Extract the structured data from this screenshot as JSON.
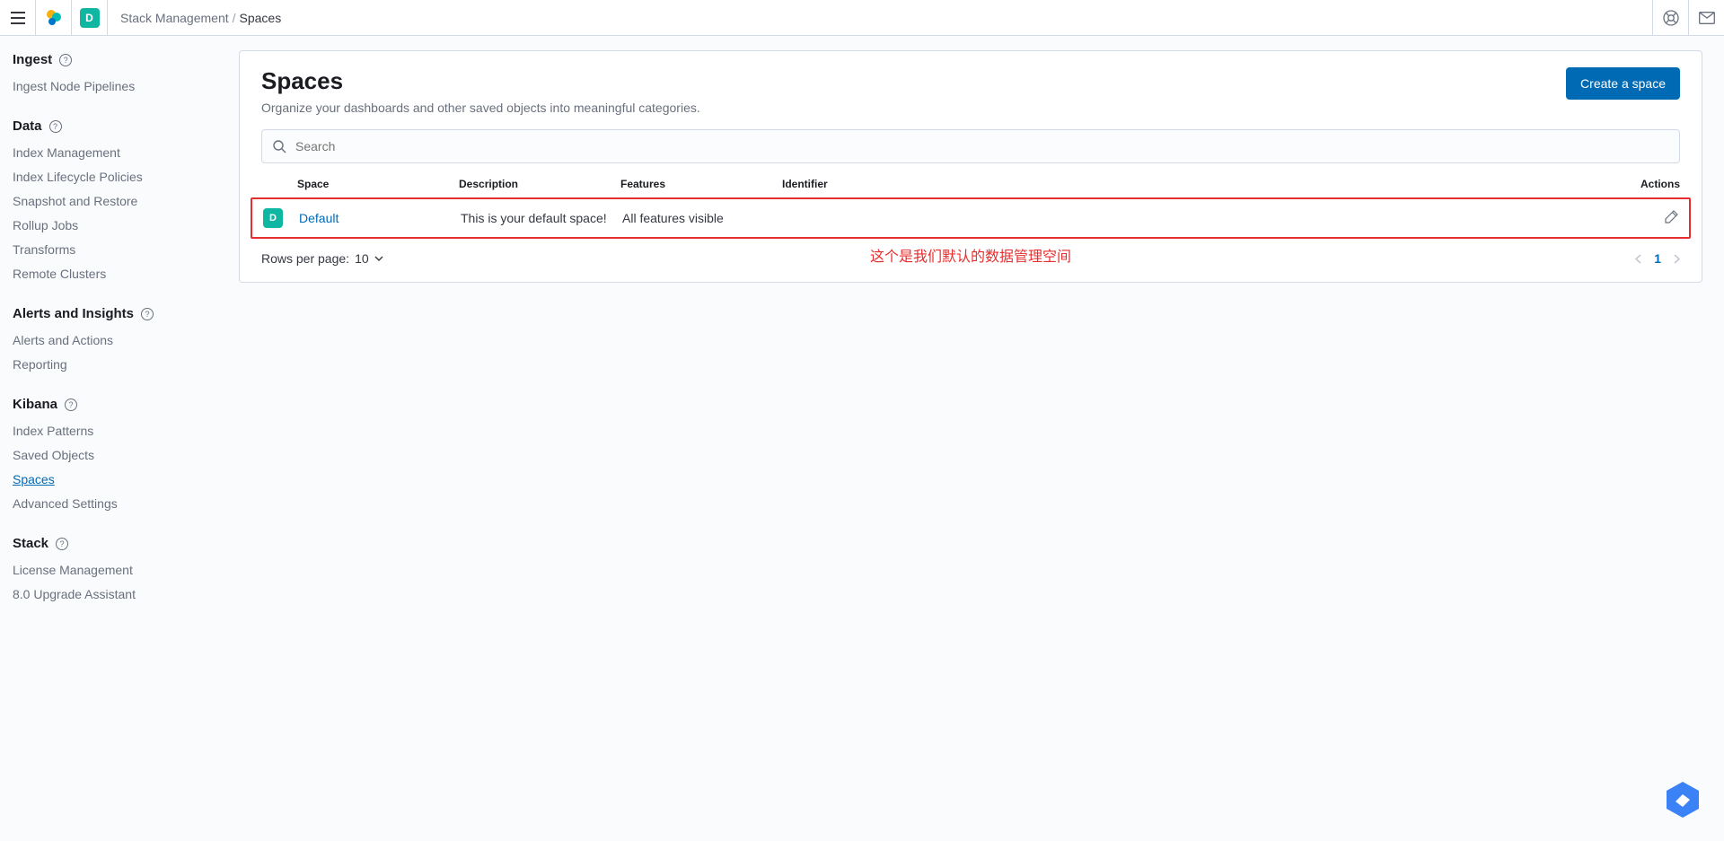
{
  "header": {
    "breadcrumb_parent": "Stack Management",
    "breadcrumb_current": "Spaces",
    "space_initial": "D"
  },
  "sidebar": {
    "sections": [
      {
        "title": "Ingest",
        "items": [
          "Ingest Node Pipelines"
        ]
      },
      {
        "title": "Data",
        "items": [
          "Index Management",
          "Index Lifecycle Policies",
          "Snapshot and Restore",
          "Rollup Jobs",
          "Transforms",
          "Remote Clusters"
        ]
      },
      {
        "title": "Alerts and Insights",
        "items": [
          "Alerts and Actions",
          "Reporting"
        ]
      },
      {
        "title": "Kibana",
        "items": [
          "Index Patterns",
          "Saved Objects",
          "Spaces",
          "Advanced Settings"
        ]
      },
      {
        "title": "Stack",
        "items": [
          "License Management",
          "8.0 Upgrade Assistant"
        ]
      }
    ],
    "active": "Spaces"
  },
  "main": {
    "title": "Spaces",
    "description": "Organize your dashboards and other saved objects into meaningful categories.",
    "create_button": "Create a space",
    "search_placeholder": "Search",
    "columns": {
      "space": "Space",
      "description": "Description",
      "features": "Features",
      "identifier": "Identifier",
      "actions": "Actions"
    },
    "rows": [
      {
        "initial": "D",
        "name": "Default",
        "description": "This is your default space!",
        "features": "All features visible",
        "identifier": ""
      }
    ],
    "annotation": "这个是我们默认的数据管理空间",
    "rows_per_page_label": "Rows per page:",
    "rows_per_page_value": "10",
    "current_page": "1"
  }
}
